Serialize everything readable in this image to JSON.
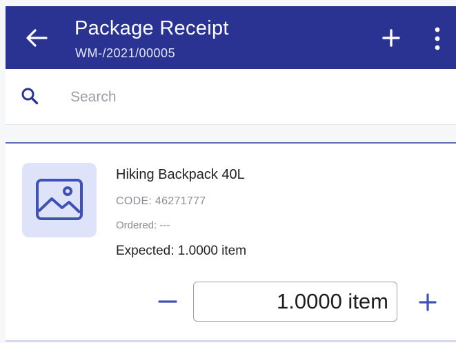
{
  "colors": {
    "appbar": "#2a3391",
    "accent": "#3f51b5",
    "thumb_bg": "#dfe3f9",
    "muted_text": "#8a8d94"
  },
  "header": {
    "title": "Package Receipt",
    "subtitle": "WM-/2021/00005",
    "back_icon": "arrow-left-icon",
    "add_icon": "plus-icon",
    "more_icon": "more-vertical-icon"
  },
  "search": {
    "icon": "search-icon",
    "placeholder": "Search",
    "value": ""
  },
  "items": [
    {
      "thumbnail_icon": "image-placeholder-icon",
      "name": "Hiking Backpack 40L",
      "code": "CODE: 46271777",
      "ordered": "Ordered: ---",
      "expected": "Expected: 1.0000 item",
      "quantity": "1.0000 item",
      "decrement_icon": "minus-icon",
      "increment_icon": "plus-icon"
    }
  ]
}
